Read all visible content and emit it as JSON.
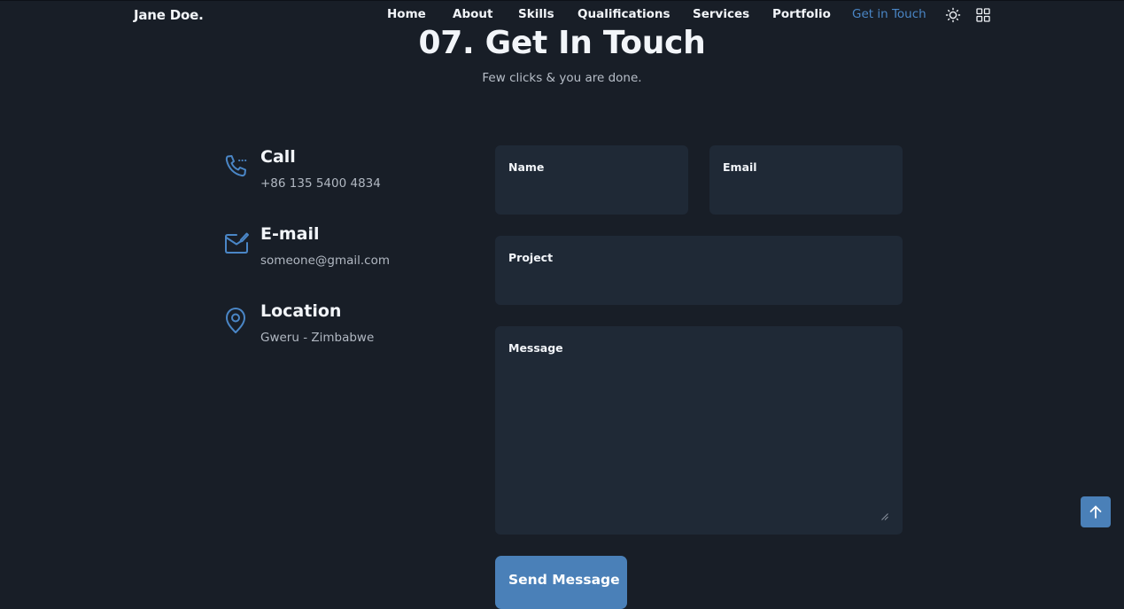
{
  "header": {
    "logo": "Jane Doe.",
    "nav": [
      {
        "label": "Home"
      },
      {
        "label": "About"
      },
      {
        "label": "Skills"
      },
      {
        "label": "Qualifications"
      },
      {
        "label": "Services"
      },
      {
        "label": "Portfolio"
      },
      {
        "label": "Get in Touch",
        "active": true
      }
    ],
    "icons": [
      "sun-icon",
      "grid-apps-icon"
    ]
  },
  "section": {
    "title": "07. Get In Touch",
    "subtitle": "Few clicks & you are done."
  },
  "contact": [
    {
      "icon": "phone-icon",
      "title": "Call",
      "value": "+86 135 5400 4834"
    },
    {
      "icon": "mail-icon",
      "title": "E-mail",
      "value": "someone@gmail.com"
    },
    {
      "icon": "location-pin-icon",
      "title": "Location",
      "value": "Gweru - Zimbabwe"
    }
  ],
  "form": {
    "name_label": "Name",
    "email_label": "Email",
    "project_label": "Project",
    "message_label": "Message",
    "submit_label": "Send Message"
  },
  "scroll_top": {
    "icon": "arrow-up-icon"
  },
  "colors": {
    "background": "#181e27",
    "field": "#1f2936",
    "accent": "#4a80b8",
    "active_link": "#4a86c6",
    "text": "#f2f5f9",
    "muted": "#b1b8c2"
  }
}
